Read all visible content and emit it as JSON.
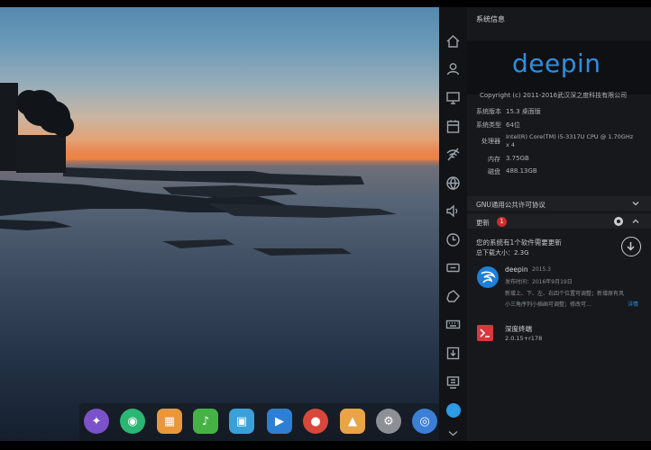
{
  "panel": {
    "title": "系统信息",
    "logo": "deepin",
    "copyright": "Copyright (c) 2011-2016武汉深之度科技有限公司",
    "info_rows": [
      {
        "label": "系统版本",
        "value": "15.3 桌面版"
      },
      {
        "label": "系统类型",
        "value": "64位"
      },
      {
        "label": "处理器",
        "value": "Intel(R) Core(TM) i5-3317U CPU @ 1.70GHz"
      },
      {
        "label": "",
        "value": "x 4"
      },
      {
        "label": "内存",
        "value": "3.75GB"
      },
      {
        "label": "磁盘",
        "value": "488.13GB"
      }
    ],
    "license": "GNU通用公共许可协议",
    "update": {
      "title": "更新",
      "badge": "1",
      "summary": "您的系统有1个软件需要更新",
      "download_size": "总下载大小：2.3G"
    },
    "apps": [
      {
        "name": "deepin",
        "version": "2015.3",
        "release_date": "发布时间：2016年9月19日",
        "desc_1": "新增上、下、左、右四个位置可调整；新增原有风",
        "desc_2": "小三角序列小插画可调整；修改可…",
        "more": "详情"
      },
      {
        "name": "深度终端",
        "version": "2.0.15+r178"
      }
    ]
  },
  "strip_icons": [
    "home-icon",
    "user-icon",
    "display-icon",
    "calendar-icon",
    "network-icon",
    "globe-icon",
    "sound-icon",
    "clock-icon",
    "power-icon",
    "mouse-icon",
    "keyboard-icon",
    "update-icon",
    "system-info-icon"
  ],
  "dock": [
    {
      "name": "launcher-icon",
      "glyph": "✦",
      "color": "#7b52c9"
    },
    {
      "name": "app-store-icon",
      "glyph": "◉",
      "color": "#2bb673"
    },
    {
      "name": "shop-icon",
      "glyph": "▦",
      "color": "#e8973a"
    },
    {
      "name": "music-icon",
      "glyph": "♪",
      "color": "#46b246"
    },
    {
      "name": "box-icon",
      "glyph": "▣",
      "color": "#3aa0d8"
    },
    {
      "name": "video-icon",
      "glyph": "▶",
      "color": "#2d7fd4"
    },
    {
      "name": "chrome-icon",
      "glyph": "●",
      "color": "#d9473a"
    },
    {
      "name": "image-icon",
      "glyph": "▲",
      "color": "#e8a445"
    },
    {
      "name": "settings-icon",
      "glyph": "⚙",
      "color": "#8c8f94"
    },
    {
      "name": "control-center-icon",
      "glyph": "◎",
      "color": "#3b7fd6"
    }
  ]
}
